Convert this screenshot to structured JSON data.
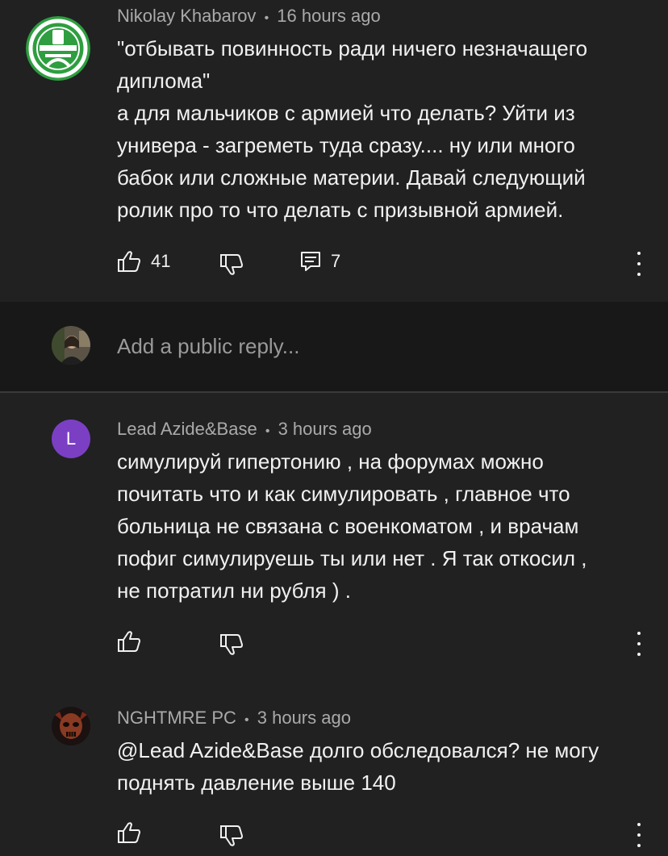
{
  "comments": [
    {
      "author": "Nikolay Khabarov",
      "time": "16 hours ago",
      "text": "\"отбывать повинность ради ничего незначащего\nдиплома\"\nа для мальчиков с армией что делать? Уйти из\nунивера - загреметь туда сразу.... ну или много\nбабок или сложные материи. Давай следующий\nролик про то что делать с призывной армией.",
      "likes": "41",
      "replies": "7",
      "avatar_color": "#2e9e3f",
      "avatar_icon": "railway-emblem-icon"
    },
    {
      "author": "Lead Azide&Base",
      "time": "3 hours ago",
      "text": "симулируй гипертонию , на форумах можно\nпочитать что и как симулировать , главное что\nбольница не связана с военкоматом , и врачам\nпофиг симулируешь ты или нет . Я так откосил ,\nне потратил ни рубля ) .",
      "avatar_letter": "L",
      "avatar_color": "#7b3fc4"
    },
    {
      "author": "NGHTMRE PC",
      "time": "3 hours ago",
      "text": "@Lead Azide&Base долго обследовался? не могу\nподнять давление выше 140",
      "avatar_icon": "skull-avatar-icon"
    }
  ],
  "reply_box": {
    "placeholder": "Add a public reply..."
  },
  "separator": "•"
}
